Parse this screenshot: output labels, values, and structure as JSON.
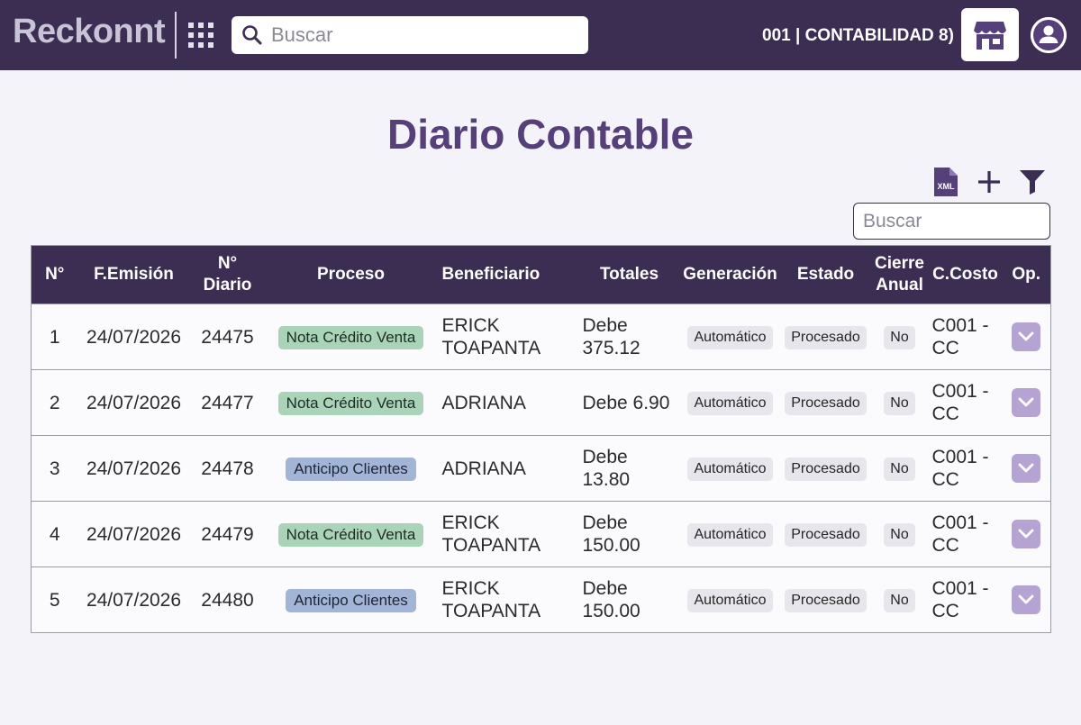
{
  "app": {
    "brand": "Reckonnt",
    "search_placeholder": "Buscar",
    "company": "001 | CONTABILIDAD 8)"
  },
  "page": {
    "title": "Diario Contable",
    "table_search_placeholder": "Buscar",
    "xml_label": "XML"
  },
  "table": {
    "headers": {
      "num": "N°",
      "emision": "F.Emisión",
      "diario_line1": "N°",
      "diario_line2": "Diario",
      "proceso": "Proceso",
      "beneficiario": "Beneficiario",
      "totales": "Totales",
      "generacion": "Generación",
      "estado": "Estado",
      "cierre_line1": "Cierre",
      "cierre_line2": "Anual",
      "costo": "C.Costo",
      "op": "Op."
    },
    "rows": [
      {
        "num": "1",
        "emision": "24/07/2026",
        "diario": "24475",
        "proceso": "Nota Crédito Venta",
        "proceso_type": "green",
        "beneficiario": "ERICK TOAPANTA",
        "totales": "Debe 375.12",
        "generacion": "Automático",
        "estado": "Procesado",
        "cierre": "No",
        "costo": "C001 - CC"
      },
      {
        "num": "2",
        "emision": "24/07/2026",
        "diario": "24477",
        "proceso": "Nota Crédito Venta",
        "proceso_type": "green",
        "beneficiario": "ADRIANA",
        "totales": "Debe 6.90",
        "generacion": "Automático",
        "estado": "Procesado",
        "cierre": "No",
        "costo": "C001 - CC"
      },
      {
        "num": "3",
        "emision": "24/07/2026",
        "diario": "24478",
        "proceso": "Anticipo Clientes",
        "proceso_type": "blue",
        "beneficiario": "ADRIANA",
        "totales": "Debe 13.80",
        "generacion": "Automático",
        "estado": "Procesado",
        "cierre": "No",
        "costo": "C001 - CC"
      },
      {
        "num": "4",
        "emision": "24/07/2026",
        "diario": "24479",
        "proceso": "Nota Crédito Venta",
        "proceso_type": "green",
        "beneficiario": "ERICK TOAPANTA",
        "totales": "Debe 150.00",
        "generacion": "Automático",
        "estado": "Procesado",
        "cierre": "No",
        "costo": "C001 - CC"
      },
      {
        "num": "5",
        "emision": "24/07/2026",
        "diario": "24480",
        "proceso": "Anticipo Clientes",
        "proceso_type": "blue",
        "beneficiario": "ERICK TOAPANTA",
        "totales": "Debe 150.00",
        "generacion": "Automático",
        "estado": "Procesado",
        "cierre": "No",
        "costo": "C001 - CC"
      }
    ]
  },
  "colors": {
    "topbar": "#3b2e52",
    "title": "#56407a",
    "pill_green": "#a9d4b8",
    "pill_blue": "#a3b5d6",
    "op_button": "#b5a4d3"
  },
  "icons": {
    "apps": "grid-apps-icon",
    "search": "search-icon",
    "store": "store-icon",
    "user": "user-icon",
    "xml": "xml-file-icon",
    "add": "plus-icon",
    "filter": "filter-icon",
    "op": "chevron-down-icon"
  }
}
